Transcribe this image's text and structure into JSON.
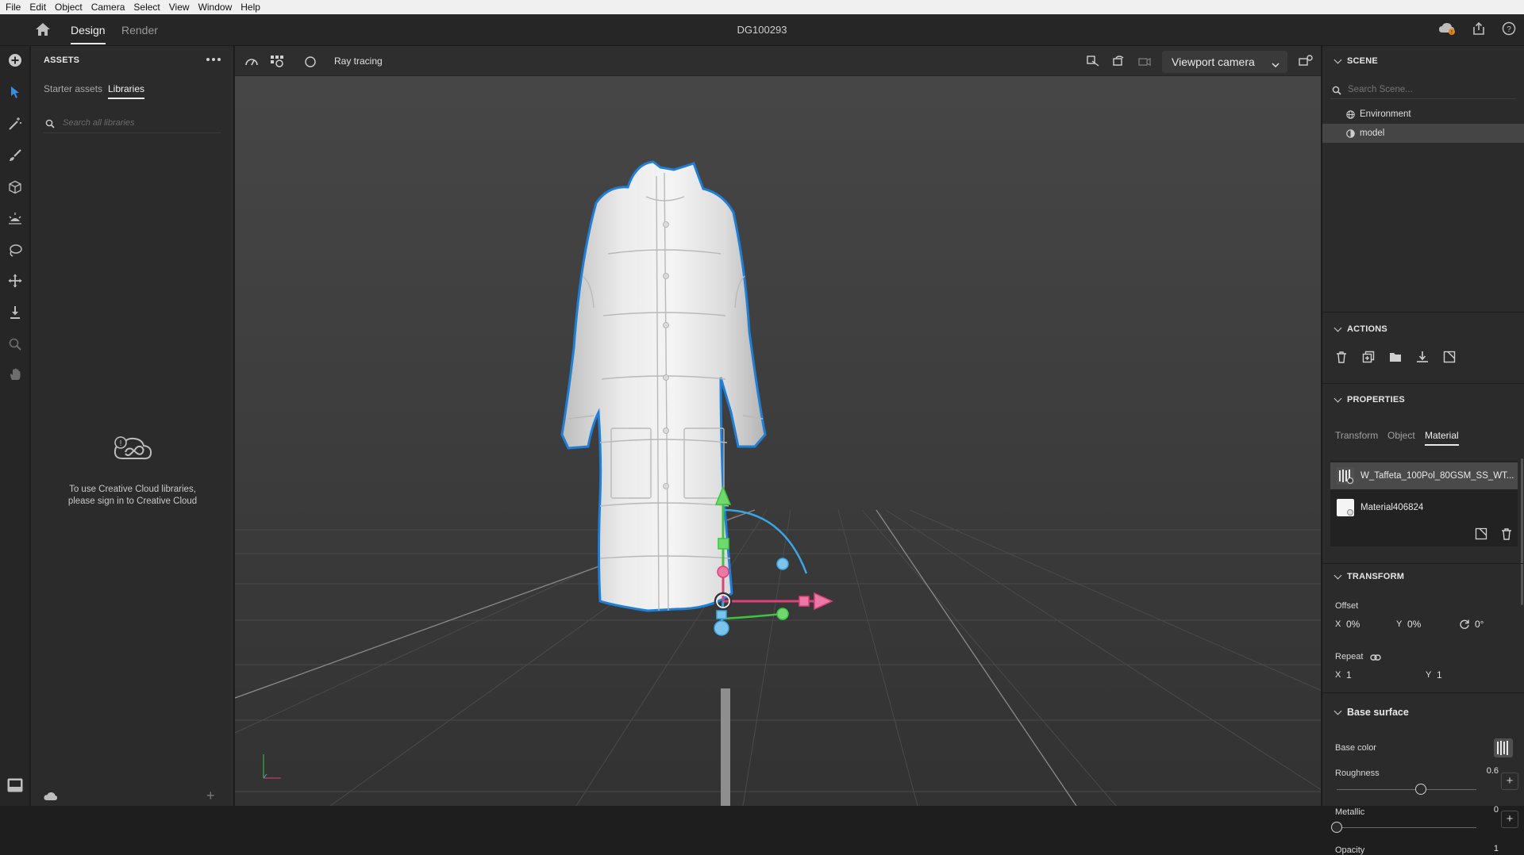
{
  "menu": [
    "File",
    "Edit",
    "Object",
    "Camera",
    "Select",
    "View",
    "Window",
    "Help"
  ],
  "topbar": {
    "tabs": [
      "Design",
      "Render"
    ],
    "active_tab": "Design",
    "doc_title": "DG100293"
  },
  "assets": {
    "title": "ASSETS",
    "tabs": [
      "Starter assets",
      "Libraries"
    ],
    "active_tab": "Libraries",
    "search_placeholder": "Search all libraries",
    "message_line1": "To use Creative Cloud libraries,",
    "message_line2": "please sign in to Creative Cloud"
  },
  "viewport": {
    "ray_tracing_label": "Ray tracing",
    "camera": "Viewport camera"
  },
  "scene": {
    "title": "SCENE",
    "search_placeholder": "Search Scene...",
    "items": [
      "Environment",
      "model"
    ],
    "selected": "model"
  },
  "actions": {
    "title": "ACTIONS"
  },
  "properties": {
    "title": "PROPERTIES",
    "tabs": [
      "Transform",
      "Object",
      "Material"
    ],
    "active_tab": "Material",
    "materials": [
      "W_Taffeta_100Pol_80GSM_SS_WT...",
      "Material406824"
    ]
  },
  "transform": {
    "title": "TRANSFORM",
    "offset_label": "Offset",
    "x_label": "X",
    "x_value": "0%",
    "y_label": "Y",
    "y_value": "0%",
    "rotation": "0°",
    "repeat_label": "Repeat",
    "repeat_x": "1",
    "repeat_y": "1"
  },
  "base_surface": {
    "title": "Base surface",
    "base_color_label": "Base color",
    "roughness_label": "Roughness",
    "roughness_value": "0.6",
    "roughness": 0.6,
    "metallic_label": "Metallic",
    "metallic_value": "0",
    "metallic": 0,
    "opacity_label": "Opacity",
    "opacity_value": "1"
  },
  "colors": {
    "accent": "#1473e6",
    "selection_outline": "#1f7fd6",
    "gizmo_x": "#e0407a",
    "gizmo_y": "#3fc43f",
    "gizmo_z": "#3aa6e0"
  }
}
